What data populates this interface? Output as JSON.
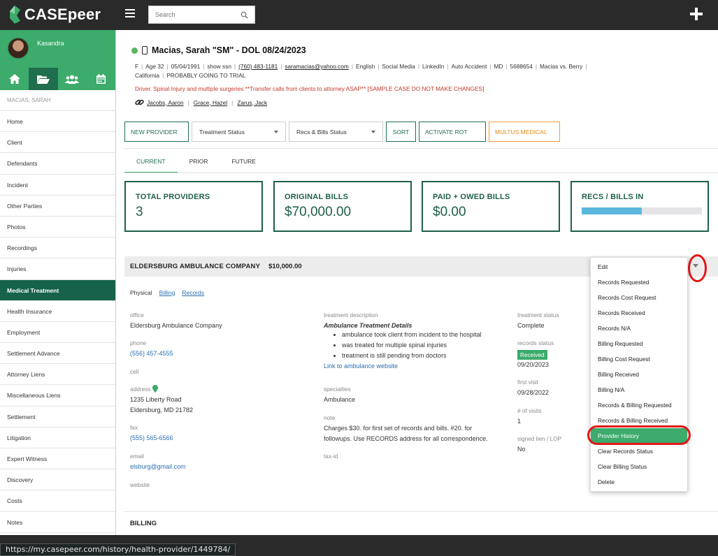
{
  "app": {
    "name": "CASEpeer",
    "search_placeholder": "Search"
  },
  "user": {
    "name": "Kasandra"
  },
  "sidebar": {
    "case_label": "MACIAS, SARAH",
    "items": [
      {
        "label": "Home"
      },
      {
        "label": "Client"
      },
      {
        "label": "Defendants"
      },
      {
        "label": "Incident"
      },
      {
        "label": "Other Parties"
      },
      {
        "label": "Photos"
      },
      {
        "label": "Recordings"
      },
      {
        "label": "Injuries"
      },
      {
        "label": "Medical Treatment"
      },
      {
        "label": "Health Insurance"
      },
      {
        "label": "Employment"
      },
      {
        "label": "Settlement Advance"
      },
      {
        "label": "Attorney Liens"
      },
      {
        "label": "Miscellaneous Liens"
      },
      {
        "label": "Settlement"
      },
      {
        "label": "Litigation"
      },
      {
        "label": "Expert Witness"
      },
      {
        "label": "Discovery"
      },
      {
        "label": "Costs"
      },
      {
        "label": "Notes"
      }
    ],
    "active_item": "Medical Treatment"
  },
  "case": {
    "title": "Macias, Sarah \"SM\" - DOL 08/24/2023",
    "meta1": [
      "F",
      "Age 32",
      "05/04/1991",
      "show ssn",
      "(760) 483-1181",
      "saramacias@yahoo.com",
      "English",
      "Social Media",
      "LinkedIn",
      "Auto Accident",
      "MD",
      "5688654",
      "Macias vs. Berry"
    ],
    "meta2": [
      "California",
      "PROBABLY GOING TO TRIAL"
    ],
    "warning": "Driver. Spinal Injury and multiple surgeries **Transfer calls from clients to attorney ASAP** [SAMPLE CASE DO NOT MAKE CHANGES]",
    "linked": [
      "Jacobs, Aaron",
      "Grace, Hazel",
      "Zarus, Jack"
    ]
  },
  "toolbar": {
    "new_provider": "NEW PROVIDER",
    "treatment_status": "Treatment Status",
    "recs_bills_status": "Recs & Bills Status",
    "sort": "SORT",
    "activate_rot": "ACTIVATE ROT",
    "multus": "MULTUS MEDICAL"
  },
  "tabs": {
    "current": "CURRENT",
    "prior": "PRIOR",
    "future": "FUTURE"
  },
  "stats": {
    "total_providers": {
      "label": "TOTAL PROVIDERS",
      "value": "3"
    },
    "original_bills": {
      "label": "ORIGINAL BILLS",
      "value": "$70,000.00"
    },
    "paid_owed": {
      "label": "PAID + OWED BILLS",
      "value": "$0.00"
    },
    "recs_bills_in": {
      "label": "RECS / BILLS IN",
      "progress": 0.5
    }
  },
  "provider": {
    "name": "ELDERSBURG AMBULANCE COMPANY",
    "amount": "$10,000.00",
    "subtabs": {
      "physical": "Physical",
      "billing": "Billing",
      "records": "Records"
    },
    "office_label": "office",
    "office": "Eldersburg Ambulance Company",
    "phone_label": "phone",
    "phone": "(556) 457-4555",
    "cell_label": "cell",
    "address_label": "address",
    "address1": "1235 Liberty Road",
    "address2": "Eldersburg, MD 21782",
    "fax_label": "fax",
    "fax": "(555) 565-6566",
    "email_label": "email",
    "email": "elsburg@gmail.com",
    "website_label": "website",
    "treatment_desc_label": "treatment description",
    "treatment_desc_title": "Ambulance Treatment Details",
    "treatment_desc_items": [
      "ambulance took client from incident to the hospital",
      "was treated for multiple spinal injuries",
      "treatment is still pending from doctors"
    ],
    "website_link": "Link to ambulance website",
    "specialties_label": "specialties",
    "specialties": "Ambulance",
    "note_label": "note",
    "note1": "Charges $30. for first set of records and bills. #20. for",
    "note2": "followups. Use RECORDS address for all correspondence.",
    "taxid_label": "tax-id",
    "treatment_status_label": "treatment status",
    "treatment_status": "Complete",
    "records_status_label": "records status",
    "records_status_badge": "Received",
    "records_status_date": "09/20/2023",
    "first_visit_label": "first visit",
    "first_visit": "09/28/2022",
    "visits_label": "# of visits",
    "visits": "1",
    "lien_label": "signed lien / LOP",
    "lien": "No"
  },
  "billing_heading": "BILLING",
  "dropdown": {
    "items": [
      "Edit",
      "Records Requested",
      "Records Cost Request",
      "Records Received",
      "Records N/A",
      "Billing Requested",
      "Billing Cost Request",
      "Billing Received",
      "Billing N/A",
      "Records & Billing Requested",
      "Records & Billing Received",
      "Provider History",
      "Clear Records Status",
      "Clear Billing Status",
      "Delete"
    ],
    "highlighted": "Provider History"
  },
  "status_url": "https://my.casepeer.com/history/health-provider/1449784/",
  "colors": {
    "brand_green": "#3cab6b",
    "dark_green": "#1f6e4e",
    "highlight_ring": "#e41616"
  }
}
